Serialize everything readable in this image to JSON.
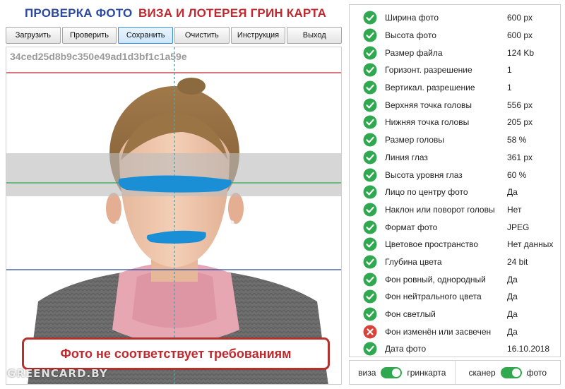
{
  "header": {
    "title_left": "ПРОВЕРКА ФОТО",
    "title_right": "ВИЗА И ЛОТЕРЕЯ ГРИН КАРТА"
  },
  "toolbar": {
    "buttons": [
      {
        "label": "Загрузить"
      },
      {
        "label": "Проверить"
      },
      {
        "label": "Сохранить",
        "active": true
      },
      {
        "label": "Очистить"
      },
      {
        "label": "Инструкция"
      },
      {
        "label": "Выход"
      }
    ]
  },
  "photo": {
    "hash": "34ced25d8b9c350e49ad1d3bf1c1a59e",
    "warning": "Фото не соответствует требованиям",
    "watermark": "GREENCARD.BY"
  },
  "checks": [
    {
      "label": "Ширина фото",
      "value": "600 px",
      "ok": true
    },
    {
      "label": "Высота фото",
      "value": "600 px",
      "ok": true
    },
    {
      "label": "Размер файла",
      "value": "124 Kb",
      "ok": true
    },
    {
      "label": "Горизонт. разрешение",
      "value": "1",
      "ok": true
    },
    {
      "label": "Вертикал. разрешение",
      "value": "1",
      "ok": true
    },
    {
      "label": "Верхняя точка головы",
      "value": "556 px",
      "ok": true
    },
    {
      "label": "Нижняя точка головы",
      "value": "205 px",
      "ok": true
    },
    {
      "label": "Размер головы",
      "value": "58 %",
      "ok": true
    },
    {
      "label": "Линия глаз",
      "value": "361 px",
      "ok": true
    },
    {
      "label": "Высота уровня глаз",
      "value": "60 %",
      "ok": true
    },
    {
      "label": "Лицо по центру фото",
      "value": "Да",
      "ok": true
    },
    {
      "label": "Наклон или поворот головы",
      "value": "Нет",
      "ok": true
    },
    {
      "label": "Формат фото",
      "value": "JPEG",
      "ok": true
    },
    {
      "label": "Цветовое пространство",
      "value": "Нет данных",
      "ok": true
    },
    {
      "label": "Глубина цвета",
      "value": "24 bit",
      "ok": true
    },
    {
      "label": "Фон ровный, однородный",
      "value": "Да",
      "ok": true
    },
    {
      "label": "Фон нейтрального цвета",
      "value": "Да",
      "ok": true
    },
    {
      "label": "Фон светлый",
      "value": "Да",
      "ok": true
    },
    {
      "label": "Фон изменён или засвечен",
      "value": "Да",
      "ok": false
    },
    {
      "label": "Дата фото",
      "value": "16.10.2018",
      "ok": true
    }
  ],
  "toggles": [
    {
      "left": "виза",
      "right": "гринкарта",
      "on": true
    },
    {
      "left": "сканер",
      "right": "фото",
      "on": true
    }
  ],
  "colors": {
    "ok": "#2fa84f",
    "fail": "#d8423a",
    "title_blue": "#2b4aa0",
    "title_red": "#c0282d"
  }
}
